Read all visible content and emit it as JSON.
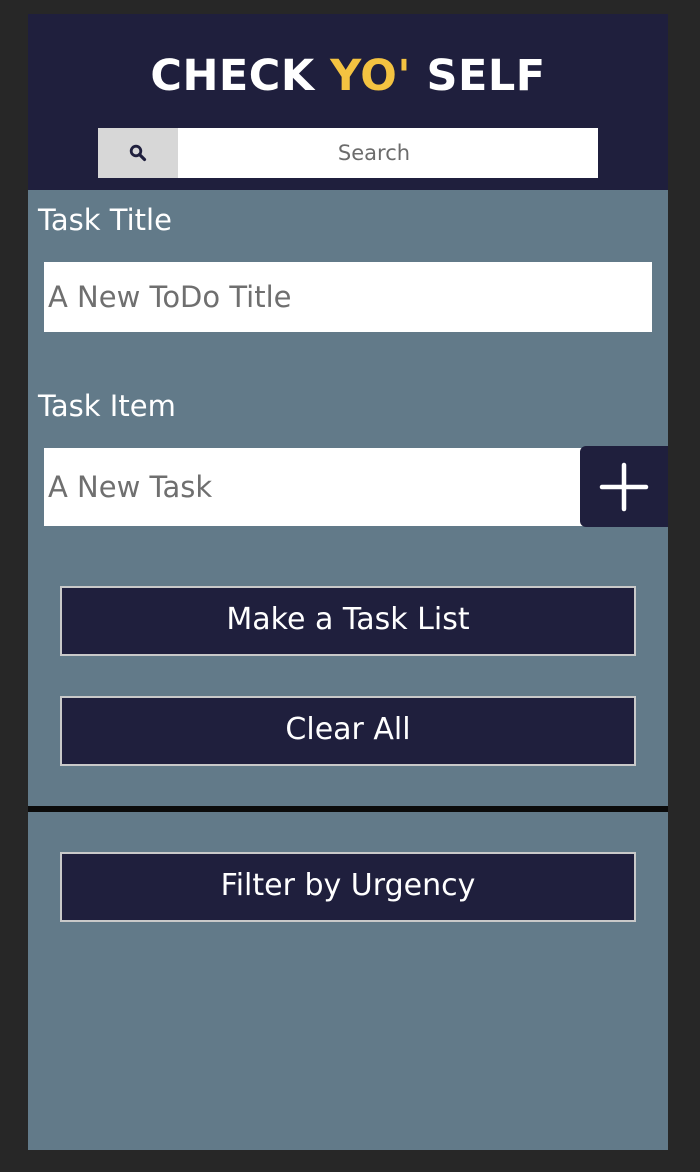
{
  "header": {
    "title_part1": "CHECK ",
    "title_accent": "YO'",
    "title_part2": " SELF",
    "accent_color": "#f4c341",
    "background_color": "#1f1f3d"
  },
  "search": {
    "icon": "search-icon",
    "placeholder": "Search"
  },
  "form": {
    "task_title_label": "Task Title",
    "task_title_placeholder": "A New ToDo Title",
    "task_item_label": "Task Item",
    "task_item_placeholder": "A New Task",
    "add_icon": "plus-icon"
  },
  "buttons": {
    "make_list": "Make a Task List",
    "clear_all": "Clear All",
    "filter_urgency": "Filter by Urgency"
  },
  "colors": {
    "panel": "#627a89",
    "page": "#272727"
  }
}
